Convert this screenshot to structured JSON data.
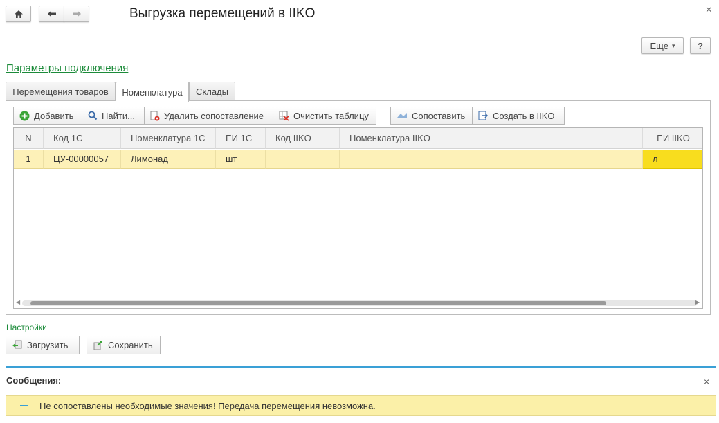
{
  "window": {
    "title": "Выгрузка перемещений в IIKO",
    "close_glyph": "×"
  },
  "header": {
    "more_label": "Еще",
    "more_caret": "▾",
    "help_label": "?"
  },
  "link": {
    "connection_params": "Параметры подключения"
  },
  "tabs": [
    {
      "label": "Перемещения товаров"
    },
    {
      "label": "Номенклатура"
    },
    {
      "label": "Склады"
    }
  ],
  "toolbar": {
    "add": "Добавить",
    "find": "Найти...",
    "delete_match": "Удалить сопоставление",
    "clear_table": "Очистить таблицу",
    "match": "Сопоставить",
    "create_iiko": "Создать в IIKO"
  },
  "grid": {
    "columns": [
      "N",
      "Код 1С",
      "Номенклатура 1С",
      "ЕИ 1С",
      "Код IIKO",
      "Номенклатура IIKO",
      "ЕИ IIKO"
    ],
    "rows": [
      [
        "1",
        "ЦУ-00000057",
        "Лимонад",
        "шт",
        "",
        "",
        "л"
      ]
    ]
  },
  "settings": {
    "label": "Настройки",
    "load": "Загрузить",
    "save": "Сохранить"
  },
  "messages": {
    "title": "Сообщения:",
    "close_glyph": "×",
    "items": [
      "Не сопоставлены необходимые значения! Передача перемещения невозможна."
    ]
  },
  "colors": {
    "accent_green": "#1c8b3a",
    "message_bar": "#3aa0d6",
    "row_highlight": "#fdf1b8",
    "cell_selected": "#f8dd1e"
  }
}
